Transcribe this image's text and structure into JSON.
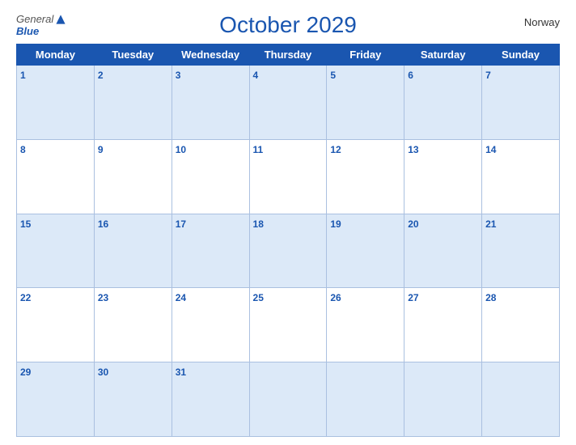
{
  "header": {
    "logo_general": "General",
    "logo_blue": "Blue",
    "title": "October 2029",
    "country": "Norway"
  },
  "days_of_week": [
    "Monday",
    "Tuesday",
    "Wednesday",
    "Thursday",
    "Friday",
    "Saturday",
    "Sunday"
  ],
  "weeks": [
    [
      1,
      2,
      3,
      4,
      5,
      6,
      7
    ],
    [
      8,
      9,
      10,
      11,
      12,
      13,
      14
    ],
    [
      15,
      16,
      17,
      18,
      19,
      20,
      21
    ],
    [
      22,
      23,
      24,
      25,
      26,
      27,
      28
    ],
    [
      29,
      30,
      31,
      null,
      null,
      null,
      null
    ]
  ]
}
